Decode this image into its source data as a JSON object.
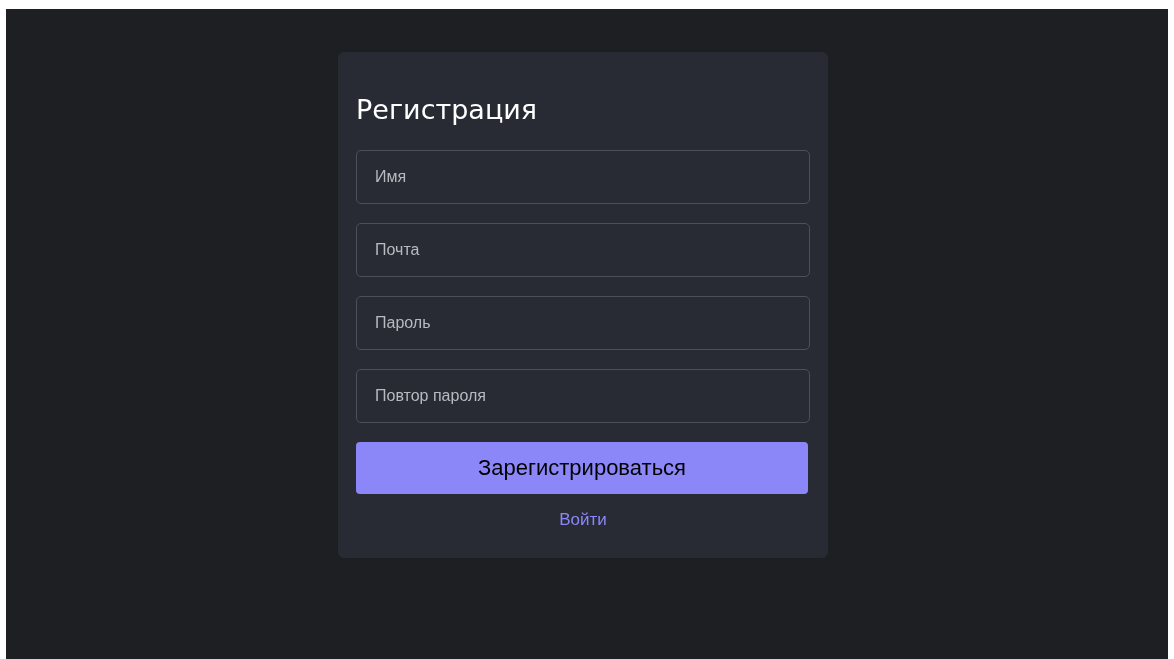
{
  "form": {
    "title": "Регистрация",
    "fields": [
      {
        "placeholder": "Имя"
      },
      {
        "placeholder": "Почта"
      },
      {
        "placeholder": "Пароль"
      },
      {
        "placeholder": "Повтор пароля"
      }
    ],
    "submit": "Зарегистрироваться",
    "link": "Войти"
  }
}
